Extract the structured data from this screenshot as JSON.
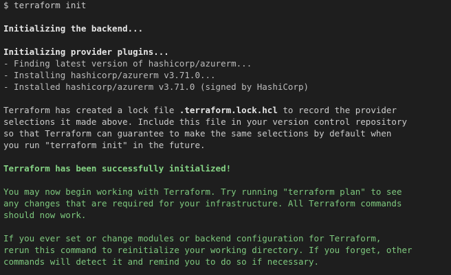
{
  "terminal": {
    "prompt": "$ terraform init",
    "backend": "Initializing the backend...",
    "provider_heading": "Initializing provider plugins...",
    "provider_steps": [
      "- Finding latest version of hashicorp/azurerm...",
      "- Installing hashicorp/azurerm v3.71.0...",
      "- Installed hashicorp/azurerm v3.71.0 (signed by HashiCorp)"
    ],
    "lockfile": {
      "line1_pre": "Terraform has created a lock file ",
      "filename": ".terraform.lock.hcl",
      "line1_post": " to record the provider",
      "line2": "selections it made above. Include this file in your version control repository",
      "line3": "so that Terraform can guarantee to make the same selections by default when",
      "line4": "you run \"terraform init\" in the future."
    },
    "success": "Terraform has been successfully initialized!",
    "next_steps": [
      "You may now begin working with Terraform. Try running \"terraform plan\" to see",
      "any changes that are required for your infrastructure. All Terraform commands",
      "should now work."
    ],
    "reinit": [
      "If you ever set or change modules or backend configuration for Terraform,",
      "rerun this command to reinitialize your working directory. If you forget, other",
      "commands will detect it and remind you to do so if necessary."
    ]
  }
}
